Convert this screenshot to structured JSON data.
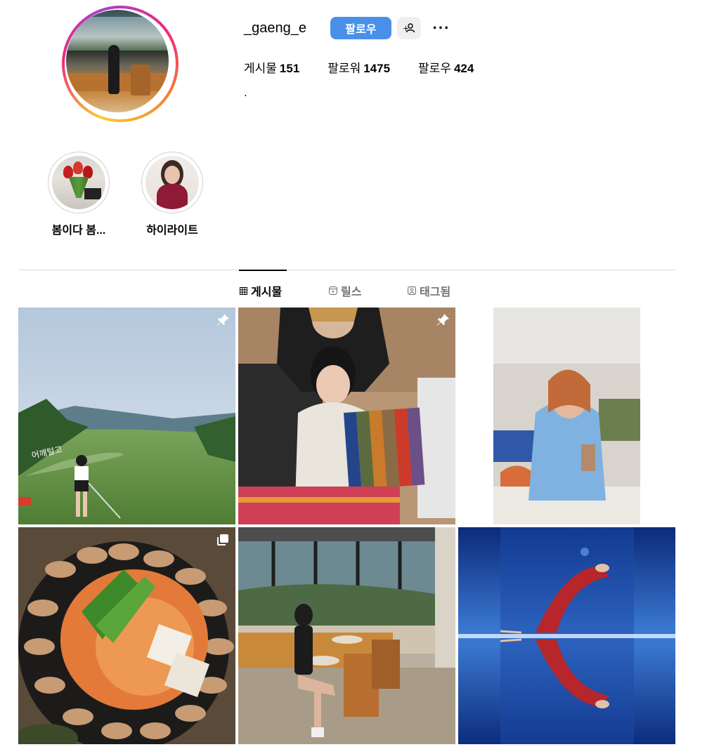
{
  "profile": {
    "username": "_gaeng_e",
    "follow_label": "팔로우",
    "more_label": "···",
    "adduser_label": "+",
    "stats": [
      {
        "label": "게시물",
        "value": "151"
      },
      {
        "label": "팔로워",
        "value": "1475"
      },
      {
        "label": "팔로우",
        "value": "424"
      }
    ],
    "bio": "."
  },
  "highlights": [
    {
      "label": "봄이다 봄..."
    },
    {
      "label": "하이라이트"
    }
  ],
  "tabs": [
    {
      "label": "게시물",
      "icon": "grid-icon",
      "active": true
    },
    {
      "label": "릴스",
      "icon": "reels-icon",
      "active": false
    },
    {
      "label": "태그됨",
      "icon": "tagged-icon",
      "active": false
    }
  ],
  "posts": [
    {
      "subject": "golf course",
      "badge": "pin-icon",
      "overlay_text": "어깨털고"
    },
    {
      "subject": "two women at office",
      "badge": "pin-icon"
    },
    {
      "subject": "woman with iced coffee",
      "badge": ""
    },
    {
      "subject": "grilled pork and kimchi",
      "badge": "carousel-icon"
    },
    {
      "subject": "woman in cafe",
      "badge": ""
    },
    {
      "subject": "underwater dancer reflection",
      "badge": ""
    }
  ],
  "colors": {
    "accent": "#4a90e8",
    "muted": "#737373",
    "divider": "#dbdbdb"
  }
}
